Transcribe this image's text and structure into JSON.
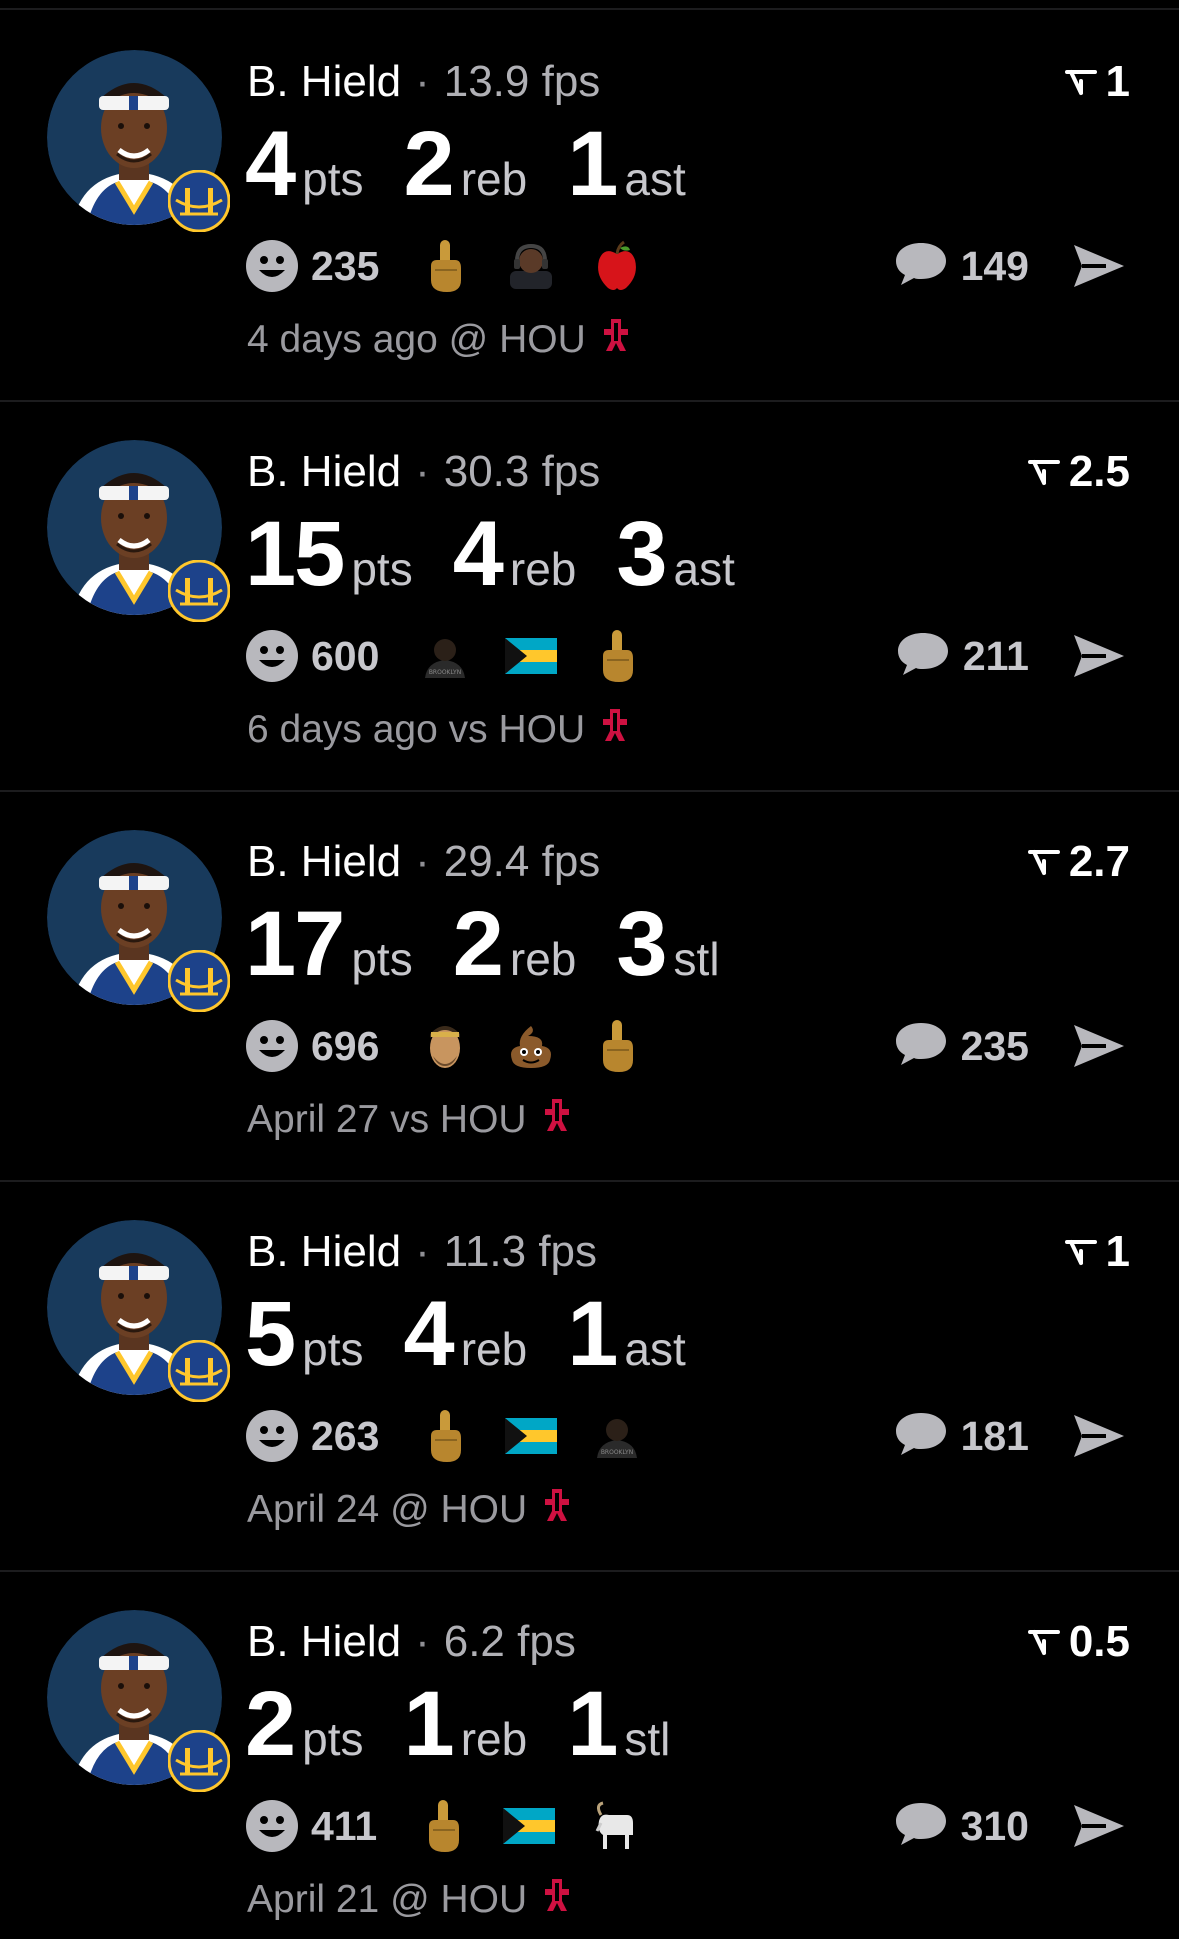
{
  "cards": [
    {
      "player": "B. Hield",
      "separator": "·",
      "fps": "13.9 fps",
      "lines_value": "1",
      "stats": [
        {
          "value": "4",
          "label": "pts"
        },
        {
          "value": "2",
          "label": "reb"
        },
        {
          "value": "1",
          "label": "ast"
        }
      ],
      "reaction_count": "235",
      "reaction_emojis": [
        "middle-finger",
        "person-headset",
        "apple"
      ],
      "comment_count": "149",
      "meta": "4 days ago @ HOU"
    },
    {
      "player": "B. Hield",
      "separator": "·",
      "fps": "30.3 fps",
      "lines_value": "2.5",
      "stats": [
        {
          "value": "15",
          "label": "pts"
        },
        {
          "value": "4",
          "label": "reb"
        },
        {
          "value": "3",
          "label": "ast"
        }
      ],
      "reaction_count": "600",
      "reaction_emojis": [
        "brooklyn-player",
        "bahamas-flag",
        "middle-finger"
      ],
      "comment_count": "211",
      "meta": "6 days ago vs HOU"
    },
    {
      "player": "B. Hield",
      "separator": "·",
      "fps": "29.4 fps",
      "lines_value": "2.7",
      "stats": [
        {
          "value": "17",
          "label": "pts"
        },
        {
          "value": "2",
          "label": "reb"
        },
        {
          "value": "3",
          "label": "stl"
        }
      ],
      "reaction_count": "696",
      "reaction_emojis": [
        "player-face",
        "poop",
        "middle-finger"
      ],
      "comment_count": "235",
      "meta": "April 27 vs HOU"
    },
    {
      "player": "B. Hield",
      "separator": "·",
      "fps": "11.3 fps",
      "lines_value": "1",
      "stats": [
        {
          "value": "5",
          "label": "pts"
        },
        {
          "value": "4",
          "label": "reb"
        },
        {
          "value": "1",
          "label": "ast"
        }
      ],
      "reaction_count": "263",
      "reaction_emojis": [
        "middle-finger",
        "bahamas-flag",
        "brooklyn-player"
      ],
      "comment_count": "181",
      "meta": "April 24 @ HOU"
    },
    {
      "player": "B. Hield",
      "separator": "·",
      "fps": "6.2 fps",
      "lines_value": "0.5",
      "stats": [
        {
          "value": "2",
          "label": "pts"
        },
        {
          "value": "1",
          "label": "reb"
        },
        {
          "value": "1",
          "label": "stl"
        }
      ],
      "reaction_count": "411",
      "reaction_emojis": [
        "middle-finger",
        "bahamas-flag",
        "goat"
      ],
      "comment_count": "310",
      "meta": "April 21 @ HOU"
    }
  ],
  "colors": {
    "background": "#000000",
    "divider": "#1c1c1e",
    "muted": "#9a9a9f",
    "warriors_blue": "#1d428a",
    "warriors_gold": "#ffc72c",
    "rockets_red": "#ce1141"
  },
  "icons": {
    "avatar": "player-headshot",
    "team_badge": "warriors-logo",
    "lines": "threshold-arrow-icon",
    "reaction": "smile-icon",
    "comment": "chat-bubble-icon",
    "share": "send-icon",
    "opponent": "rockets-logo"
  }
}
